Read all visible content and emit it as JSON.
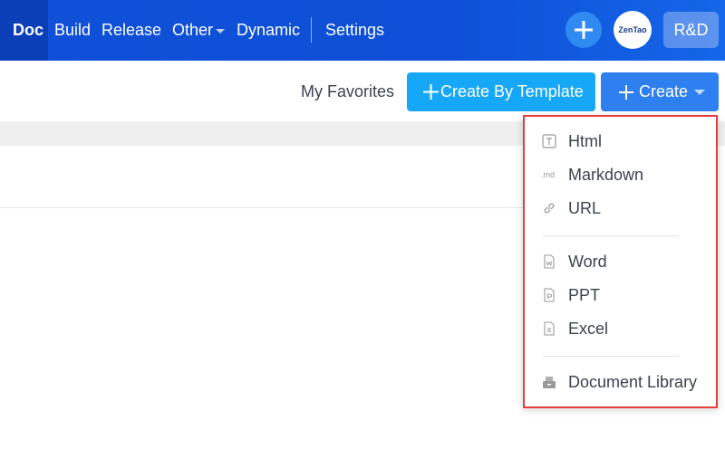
{
  "nav": {
    "items": [
      {
        "label": "Doc",
        "active": true
      },
      {
        "label": "Build"
      },
      {
        "label": "Release"
      },
      {
        "label": "Other"
      },
      {
        "label": "Dynamic"
      },
      {
        "label": "Settings"
      }
    ],
    "avatar_text": "ZenTao",
    "team_button": "R&D"
  },
  "toolbar": {
    "favorites_label": "My Favorites",
    "create_by_template_label": "Create By Template",
    "create_label": "Create"
  },
  "create_menu": {
    "items": [
      {
        "label": "Html",
        "icon": "html-doc-icon"
      },
      {
        "label": "Markdown",
        "icon": "markdown-icon",
        "icon_text": ".md"
      },
      {
        "label": "URL",
        "icon": "link-icon"
      },
      {
        "label": "Word",
        "icon": "word-doc-icon"
      },
      {
        "label": "PPT",
        "icon": "ppt-doc-icon"
      },
      {
        "label": "Excel",
        "icon": "excel-doc-icon"
      },
      {
        "label": "Document Library",
        "icon": "document-library-icon"
      }
    ]
  },
  "colors": {
    "topbar": "#0d4fd6",
    "template_button": "#16a8f7",
    "create_button": "#2e7ff0",
    "highlight_border": "#e53e3e"
  }
}
